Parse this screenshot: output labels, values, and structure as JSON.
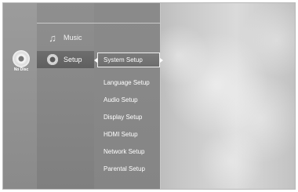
{
  "disc_status": {
    "label": "No Disc",
    "icon": "disc-icon"
  },
  "main_menu": {
    "items": [
      {
        "label": "Music",
        "icon": "music-icon",
        "selected": false
      },
      {
        "label": "Setup",
        "icon": "gear-icon",
        "selected": true
      }
    ]
  },
  "setup_menu": {
    "selected": "System Setup",
    "items": [
      "Language Setup",
      "Audio Setup",
      "Display Setup",
      "HDMI Setup",
      "Network Setup",
      "Parental Setup"
    ]
  }
}
